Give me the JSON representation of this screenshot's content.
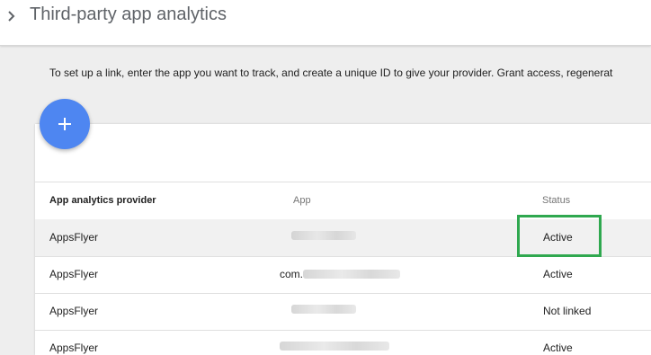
{
  "header": {
    "title": "Third-party app analytics",
    "back_icon": "chevron-right-icon"
  },
  "description": "To set up a link, enter the app you want to track, and create a unique ID to give your provider. Grant access, regenerat",
  "fab": {
    "icon": "plus-icon",
    "color": "#4e86f1"
  },
  "table": {
    "columns": {
      "provider": "App analytics provider",
      "app": "App",
      "status": "Status"
    },
    "rows": [
      {
        "provider": "AppsFlyer",
        "app": "",
        "status": "Active"
      },
      {
        "provider": "AppsFlyer",
        "app": "com.",
        "status": "Active"
      },
      {
        "provider": "AppsFlyer",
        "app": "",
        "status": "Not linked"
      },
      {
        "provider": "AppsFlyer",
        "app": "",
        "status": "Active"
      }
    ]
  },
  "annotation": {
    "highlight_color": "#2fa84f",
    "target": "table.rows.0.status"
  }
}
